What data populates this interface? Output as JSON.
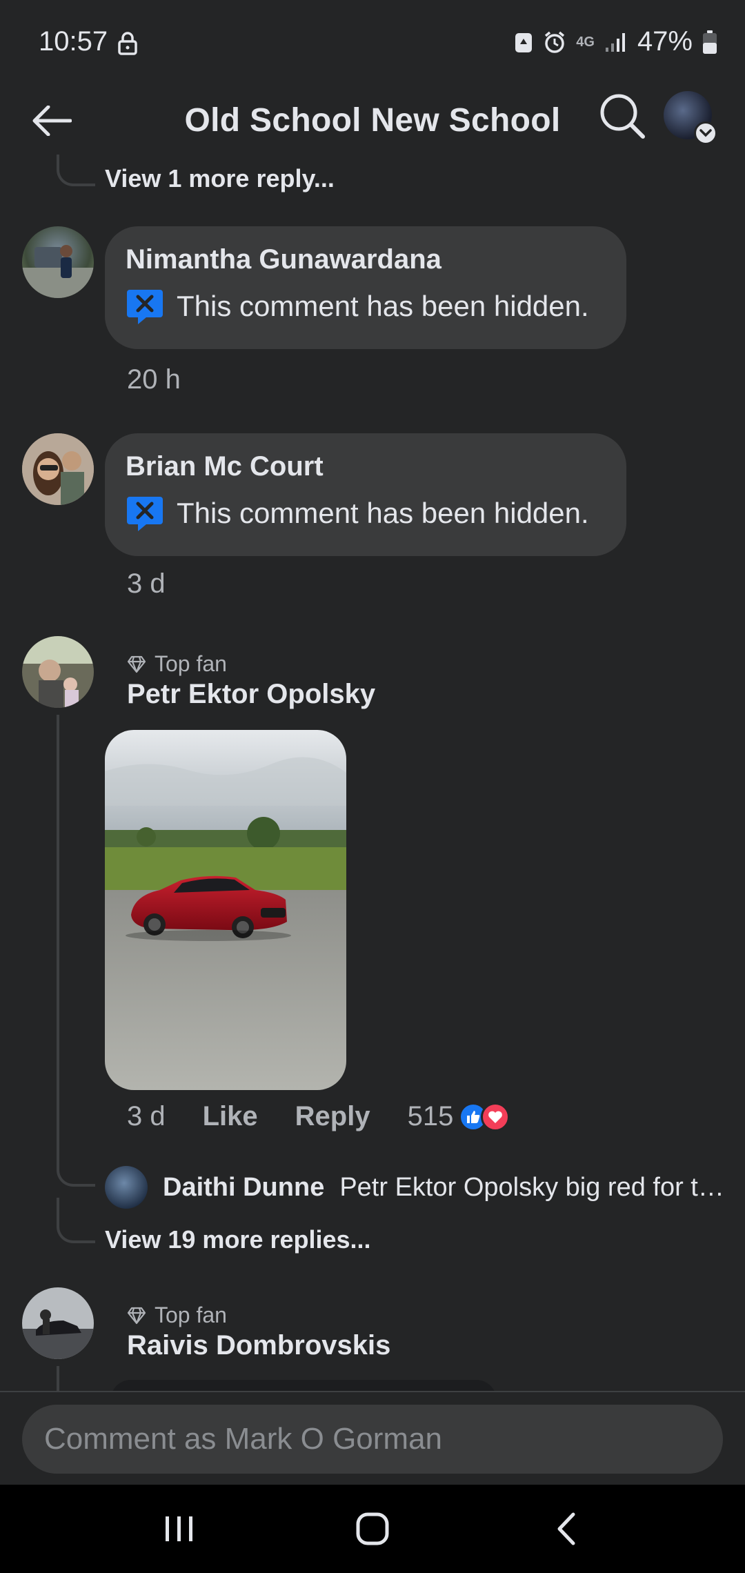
{
  "status_bar": {
    "time": "10:57",
    "network": "4G",
    "battery": "47%"
  },
  "header": {
    "title": "Old School New School"
  },
  "thread": {
    "view_more_top": "View 1 more reply...",
    "comments": [
      {
        "author": "Nimantha Gunawardana",
        "text": "This comment has been hidden.",
        "time": "20 h"
      },
      {
        "author": "Brian Mc Court",
        "text": "This comment has been hidden.",
        "time": "3 d"
      }
    ],
    "photo_comment": {
      "badge": "Top fan",
      "author": "Petr Ektor Opolsky",
      "time": "3 d",
      "like_label": "Like",
      "reply_label": "Reply",
      "reaction_count": "515",
      "reply_preview": {
        "author": "Daithi Dunne",
        "text": "Petr Ektor Opolsky  big red for th…"
      },
      "view_more": "View 19 more replies..."
    },
    "next_comment": {
      "badge": "Top fan",
      "author": "Raivis Dombrovskis"
    }
  },
  "composer": {
    "placeholder": "Comment as Mark O Gorman"
  },
  "colors": {
    "background": "#242526",
    "bubble": "#3a3b3c",
    "accent": "#1877f2",
    "love": "#f33e58"
  }
}
